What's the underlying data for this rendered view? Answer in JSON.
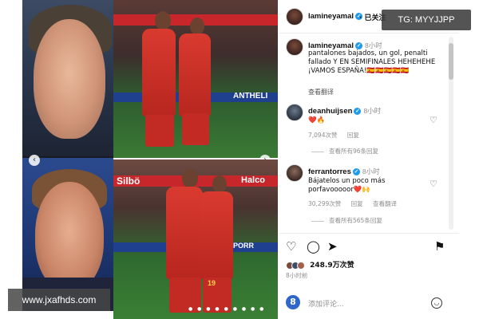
{
  "post": {
    "author": "lamineyamal",
    "follow_label": "· 已关注",
    "time_ago": "8小时",
    "caption": "pantalones bajados, un gol, penalti fallado Y EN SEMIFINALES HEHEHEHE ¡VAMOS ESPAÑA!🇪🇸🇪🇸🇪🇸🇪🇸🇪🇸",
    "translate_label": "查看翻译"
  },
  "photo": {
    "banner_top": "ANTHELI",
    "banner_bottom_left": "Silbö",
    "banner_bottom_right": "Halco",
    "banner_mid_right": "PORR",
    "number_label": "19"
  },
  "comments": [
    {
      "user": "deanhuijsen",
      "time_ago": "8小时",
      "text": "❤️🔥",
      "likes": "7,094次赞",
      "reply_label": "回复",
      "view_replies": "查看所有96条回复"
    },
    {
      "user": "ferrantorres",
      "time_ago": "8小时",
      "text": "Bájatelos un poco más porfavooooor❤️🙌",
      "likes": "30,299次赞",
      "reply_label": "回复",
      "translate_label": "查看翻译",
      "view_replies": "查看所有565条回复"
    }
  ],
  "actions": {
    "like_icon": "heart-icon",
    "comment_icon": "comment-icon",
    "share_icon": "send-icon",
    "save_icon": "bookmark-icon",
    "likes_count": "248.9万次赞",
    "posted_ago": "8小时前",
    "comment_placeholder": "添加评论..."
  },
  "overlays": {
    "telegram_badge": "TG: MYYJJPP",
    "site_watermark": "www.jxafhds.com"
  },
  "colors": {
    "verified": "#1d9bf0",
    "spain_red": "#c7262a",
    "muted_text": "#8e8e8e"
  }
}
